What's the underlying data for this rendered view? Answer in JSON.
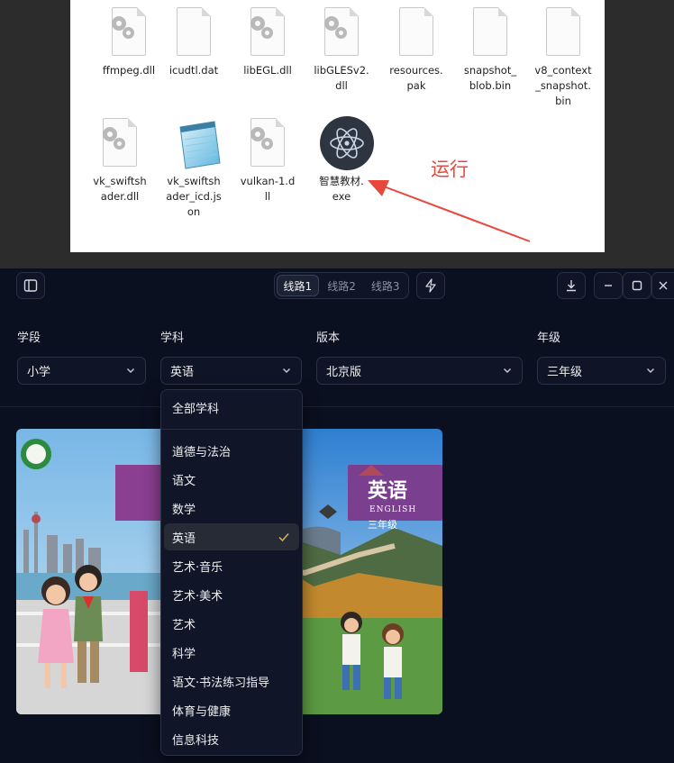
{
  "explorer": {
    "files": [
      {
        "name": "ffmpeg.dll",
        "icon": "dll-gear-icon"
      },
      {
        "name": "icudtl.dat",
        "icon": "blank-file-icon"
      },
      {
        "name": "libEGL.dll",
        "icon": "dll-gear-icon"
      },
      {
        "name": "libGLESv2.\ndll",
        "icon": "dll-gear-icon"
      },
      {
        "name": "resources.\npak",
        "icon": "blank-file-icon"
      },
      {
        "name": "snapshot_\nblob.bin",
        "icon": "blank-file-icon"
      },
      {
        "name": "v8_context\n_snapshot.\nbin",
        "icon": "blank-file-icon"
      },
      {
        "name": "vk_swiftsh\nader.dll",
        "icon": "dll-gear-icon"
      },
      {
        "name": "vk_swiftsh\nader_icd.js\non",
        "icon": "notepad-icon"
      },
      {
        "name": "vulkan-1.d\nll",
        "icon": "dll-gear-icon"
      },
      {
        "name": "智慧教材.\nexe",
        "icon": "electron-app-icon"
      }
    ],
    "annotation": "运行",
    "annotation_color": "#e8473c"
  },
  "titlebar": {
    "lines": [
      "线路1",
      "线路2",
      "线路3"
    ],
    "active_line": "线路1",
    "icons": [
      "sidebar-toggle-icon",
      "lightning-icon",
      "download-icon",
      "minimize-icon",
      "maximize-icon",
      "close-icon"
    ]
  },
  "filters": {
    "stage": {
      "label": "学段",
      "value": "小学"
    },
    "subject": {
      "label": "学科",
      "value": "英语"
    },
    "edition": {
      "label": "版本",
      "value": "北京版"
    },
    "grade": {
      "label": "年级",
      "value": "三年级"
    }
  },
  "subject_dropdown": {
    "items": [
      "全部学科",
      "道德与法治",
      "语文",
      "数学",
      "英语",
      "艺术·音乐",
      "艺术·美术",
      "艺术",
      "科学",
      "语文·书法练习指导",
      "体育与健康",
      "信息科技"
    ],
    "selected": "英语",
    "check_color": "#d8b35a"
  },
  "books": {
    "cover_title": "英语",
    "cover_subtitle": "ENGLISH",
    "cover_grade": "三年级"
  },
  "colors": {
    "app_bg": "#0b1020",
    "accent_red": "#e8473c",
    "cover_purple": "#7a3f8f"
  }
}
